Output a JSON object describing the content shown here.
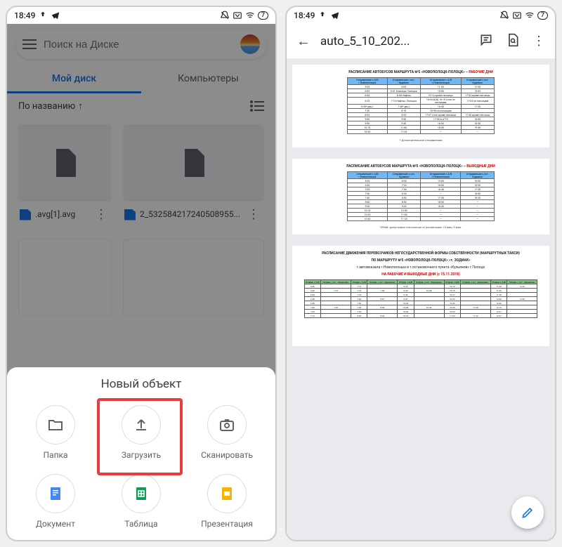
{
  "status": {
    "time": "18:49",
    "battery": "7"
  },
  "left": {
    "search_placeholder": "Поиск на Диске",
    "tabs": {
      "mydisk": "Мой диск",
      "computers": "Компьютеры"
    },
    "sort": "По названию",
    "files": [
      {
        "name": ".avg[1].avg"
      },
      {
        "name": "2_532584217240508955..."
      }
    ],
    "sheet_title": "Новый объект",
    "sheet": {
      "folder": "Папка",
      "upload": "Загрузить",
      "scan": "Сканировать",
      "doc": "Документ",
      "sheet": "Таблица",
      "slides": "Презентация"
    }
  },
  "right": {
    "title": "auto_5_10_202...",
    "section1_title": "РАСПИСАНИЕ АВТОБУСОВ МАРШРУТА №5 «НОВОПОЛОЦК-ПОЛОЦК» – ",
    "section1_label": "РАБОЧИЕ ДНИ",
    "section2_title": "РАСПИСАНИЕ АВТОБУСОВ МАРШРУТА №5 «НОВОПОЛОЦК-ПОЛОЦК» – ",
    "section2_label": "ВЫХОДНЫЕ ДНИ",
    "section3_title1": "РАСПИСАНИЕ ДВИЖЕНИЯ ПЕРЕВОЗЧИКОВ НЕГОСУДАРСТВЕННОЙ ФОРМЫ СОБСТВЕННОСТИ (МАРШРУТНЫХ ТАКСИ)",
    "section3_title2": "ПО МАРШРУТУ №5 «НОВОПОЛОЦК-ПОЛОЦК» «т. ЗОДИАК»",
    "section3_sub": "г.автовокзала г.Новополоцка и т.остановочного пункта «Кульянов» г.Полоцк",
    "section3_label": "НА РАБОЧИЕ И ВЫХОДНЫЕ ДНИ (с 15.11.2018)",
    "note1": "* Дополнительные отправления",
    "note2": "ПРИМ: допустимое отклонение от расписания: +3 мин;-5 мин.",
    "headers1": [
      "Отправление с А/В г.Новополоцка",
      "Отправление с ост. Крумино",
      "Отправление с А/В г.Новополоцка",
      "Отправление с ост. Крумино"
    ],
    "rows1": [
      [
        "5-35",
        "6-05",
        "11-30",
        "12-30"
      ],
      [
        "6-03",
        "6-41 Клясицы Полоцка",
        "15-05",
        "15-55"
      ],
      [
        "6-08",
        "6-58 Нафтан",
        "16-14 кроме пятницы",
        "17-04 кроме пятницы"
      ],
      [
        "6-25",
        "7-15 Нафтан. Полоцка",
        "16-04 вСЩ 16-10 с/пж по пятницам",
        "17-04 по пятницам"
      ],
      [
        "6-50* дан.)",
        "7-40* дан.)",
        "16-40",
        "17-30"
      ],
      [
        "7-20",
        "8-10",
        "16-50 по пятницам",
        "—"
      ],
      [
        "8-05",
        "8-55",
        "17-07 с/пж кроме пятницы",
        "17-30 кроме пятницы"
      ],
      [
        "9-00",
        "9-50",
        "17-05 в нГТЗ",
        "18-00"
      ],
      [
        "9-00",
        "9-30",
        "18-00",
        "18-50"
      ],
      [
        "10-10",
        "11-00",
        "18-30",
        "19-50"
      ],
      [
        "10-35",
        "11-25",
        "—",
        "—"
      ]
    ],
    "rows2": [
      [
        "5-35",
        "6-05",
        "15-00",
        "16-00"
      ],
      [
        "6-30",
        "7-20",
        "16-00",
        "16-50"
      ],
      [
        "7-05",
        "7-55",
        "16-40",
        "17-30"
      ],
      [
        "7-30",
        "8-35",
        "—",
        "18-00"
      ],
      [
        "7-40",
        "8-50",
        "17-30",
        "18-20"
      ],
      [
        "8-00",
        "8-50",
        "18-00",
        "—"
      ],
      [
        "9-20",
        "9-20",
        "18-30",
        "—"
      ],
      [
        "10-10",
        "10-50",
        "—",
        "—"
      ],
      [
        "10-35",
        "11-00",
        "—",
        "—"
      ],
      [
        "10-35",
        "11-25",
        "—",
        "—"
      ]
    ],
    "headers3": [
      "Отправ. с А/В",
      "Отправ. с ост. «Кульянов»",
      "Отправ. с А/В",
      "Отправ. с ост. «Кульянов»",
      "Отправ. с А/В",
      "Отправ. с ост. «Кульянов»",
      "Отправ. с А/В",
      "Отправ. с ост. «Кульянов»",
      "Отправ. с А/В",
      "Отправ. с ост. «Кульянов»"
    ],
    "rows3": [
      [
        "5-36",
        "",
        "7-15",
        "",
        "9-20",
        "",
        "10-12",
        "",
        "11-40",
        "12-22"
      ],
      [
        "6-30",
        "7-12",
        "7-18",
        "7-50",
        "9-40",
        "10-28",
        "10-18",
        "",
        "11-42",
        ""
      ],
      [
        "6-30",
        "",
        "7-24",
        "",
        "9-46",
        "",
        "10-27",
        "",
        "11-48",
        ""
      ],
      [
        "6-48",
        "",
        "7-30",
        "8-07",
        "9-57",
        "",
        "10-33",
        "",
        "12-00",
        "12-42"
      ],
      [
        "6-58",
        "",
        "7-36",
        "",
        "10-03",
        "",
        "10-36",
        "",
        "12-06",
        ""
      ],
      [
        "7-00",
        "7-42",
        "7-48",
        "8-30",
        "10-00",
        "10-42",
        "10-48",
        "11-30",
        "12-15",
        ""
      ],
      [
        "7-04",
        "",
        "7-54",
        "",
        "10-06",
        "",
        "10-54",
        "",
        "12-21",
        ""
      ],
      [
        "7-12",
        "",
        "8-00",
        "8-42",
        "10-18",
        "",
        "11-00",
        "11-42",
        "12-27",
        ""
      ]
    ]
  }
}
